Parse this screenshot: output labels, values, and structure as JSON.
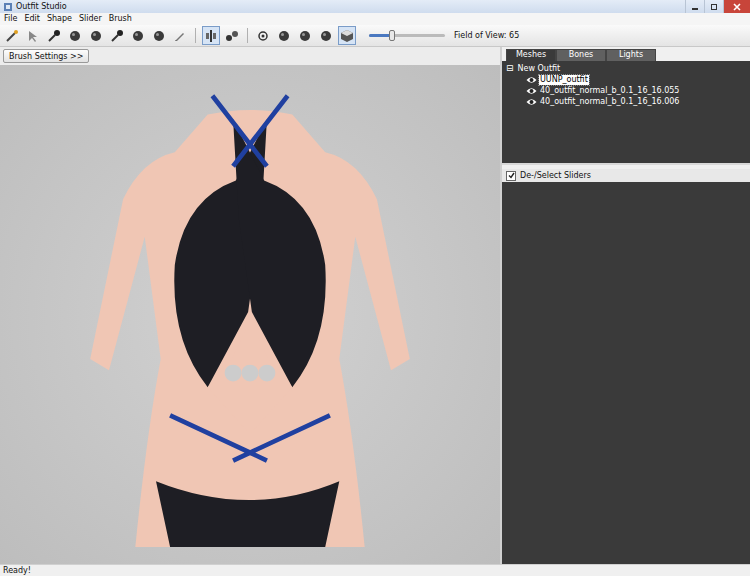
{
  "window": {
    "title": "Outfit Studio"
  },
  "menu": [
    "File",
    "Edit",
    "Shape",
    "Slider",
    "Brush"
  ],
  "toolbar": {
    "tools": [
      {
        "kind": "wand",
        "selected": false
      },
      {
        "kind": "select",
        "selected": false
      },
      {
        "kind": "brush",
        "selected": false
      },
      {
        "kind": "sphere",
        "selected": false
      },
      {
        "kind": "sphere",
        "selected": false
      },
      {
        "kind": "brush",
        "selected": false
      },
      {
        "kind": "sphere",
        "selected": false
      },
      {
        "kind": "sphere",
        "selected": false
      },
      {
        "kind": "pencil",
        "selected": false
      },
      {
        "kind": "mirror",
        "selected": true
      },
      {
        "kind": "link",
        "selected": false
      },
      {
        "kind": "dot",
        "selected": false
      },
      {
        "kind": "sphere",
        "selected": false
      },
      {
        "kind": "sphere",
        "selected": false
      },
      {
        "kind": "sphere",
        "selected": false
      },
      {
        "kind": "cube",
        "selected": true
      }
    ],
    "field_of_view": {
      "label": "Field of View: 65",
      "level": 0.3
    }
  },
  "brush_settings_button": "Brush Settings >>",
  "tabs": [
    {
      "label": "Meshes",
      "selected": true
    },
    {
      "label": "Bones",
      "selected": false
    },
    {
      "label": "Lights",
      "selected": false
    }
  ],
  "mesh_tree": {
    "root": {
      "label": "New Outfit",
      "toggle": "⊟",
      "expanded": true
    },
    "items": [
      {
        "label": "UUNP_outfit",
        "visible": true,
        "selected": true
      },
      {
        "label": "40_outfit_normal_b_0.1_16_16.055",
        "visible": true,
        "selected": false
      },
      {
        "label": "40_outfit_normal_b_0.1_16_16.006",
        "visible": true,
        "selected": false
      }
    ]
  },
  "sliders_panel": {
    "label": "De-/Select Sliders",
    "checked": true
  },
  "status_bar": {
    "text": "Ready!"
  }
}
